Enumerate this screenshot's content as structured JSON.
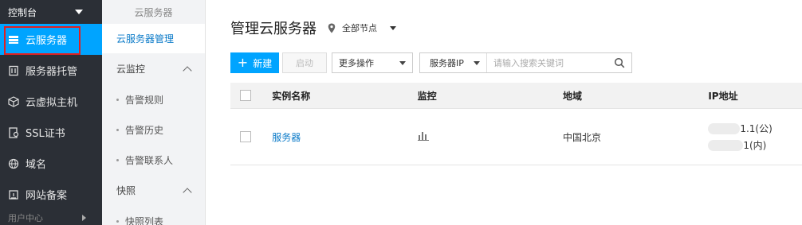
{
  "nav": {
    "console": "控制台",
    "items": [
      {
        "label": "云服务器",
        "icon": "server-icon",
        "active": true
      },
      {
        "label": "服务器托管",
        "icon": "rack-icon"
      },
      {
        "label": "云虚拟主机",
        "icon": "cube-icon"
      },
      {
        "label": "SSL证书",
        "icon": "certificate-icon"
      },
      {
        "label": "域名",
        "icon": "globe-icon"
      },
      {
        "label": "网站备案",
        "icon": "record-icon"
      }
    ],
    "user_center": "用户中心"
  },
  "subnav": {
    "title": "云服务器",
    "active_item": "云服务器管理",
    "groups": [
      {
        "label": "云监控",
        "items": [
          "告警规则",
          "告警历史",
          "告警联系人"
        ]
      },
      {
        "label": "快照",
        "items": [
          "快照列表"
        ]
      }
    ]
  },
  "main": {
    "title": "管理云服务器",
    "region": "全部节点",
    "toolbar": {
      "new_label": "新建",
      "start_label": "启动",
      "more_label": "更多操作",
      "search_key": "服务器IP",
      "search_placeholder": "请输入搜索关键词"
    },
    "table": {
      "headers": [
        "实例名称",
        "监控",
        "地域",
        "IP地址"
      ],
      "rows": [
        {
          "name": "服务器",
          "region": "中国北京",
          "ip_public": "1.1(公)",
          "ip_private": "1(内)"
        }
      ]
    }
  },
  "colors": {
    "accent": "#00a4ff",
    "highlight": "#e02020",
    "nav_bg": "#2b2f36"
  }
}
